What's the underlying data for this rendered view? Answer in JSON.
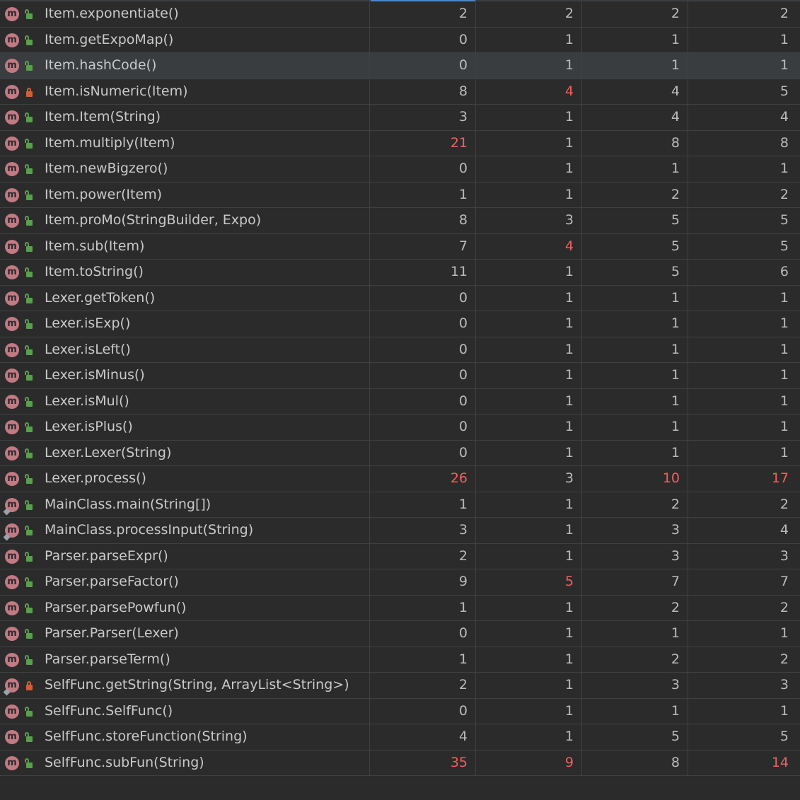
{
  "colors": {
    "background": "#2b2b2b",
    "text": "#bbbbbb",
    "warning_value": "#f16060",
    "method_icon": "#c27a84",
    "public_lock": "#5a9e4e",
    "private_lock": "#d05f36"
  },
  "rows": [
    {
      "method": "Item.exponentiate()",
      "values": [
        "2",
        "2",
        "2",
        "2"
      ],
      "red": [
        false,
        false,
        false,
        false
      ],
      "access": "public",
      "static": false,
      "selected": false
    },
    {
      "method": "Item.getExpoMap()",
      "values": [
        "0",
        "1",
        "1",
        "1"
      ],
      "red": [
        false,
        false,
        false,
        false
      ],
      "access": "public",
      "static": false,
      "selected": false
    },
    {
      "method": "Item.hashCode()",
      "values": [
        "0",
        "1",
        "1",
        "1"
      ],
      "red": [
        false,
        false,
        false,
        false
      ],
      "access": "public",
      "static": false,
      "selected": true
    },
    {
      "method": "Item.isNumeric(Item)",
      "values": [
        "8",
        "4",
        "4",
        "5"
      ],
      "red": [
        false,
        true,
        false,
        false
      ],
      "access": "private",
      "static": false,
      "selected": false
    },
    {
      "method": "Item.Item(String)",
      "values": [
        "3",
        "1",
        "4",
        "4"
      ],
      "red": [
        false,
        false,
        false,
        false
      ],
      "access": "public",
      "static": false,
      "selected": false
    },
    {
      "method": "Item.multiply(Item)",
      "values": [
        "21",
        "1",
        "8",
        "8"
      ],
      "red": [
        true,
        false,
        false,
        false
      ],
      "access": "public",
      "static": false,
      "selected": false
    },
    {
      "method": "Item.newBigzero()",
      "values": [
        "0",
        "1",
        "1",
        "1"
      ],
      "red": [
        false,
        false,
        false,
        false
      ],
      "access": "public",
      "static": false,
      "selected": false
    },
    {
      "method": "Item.power(Item)",
      "values": [
        "1",
        "1",
        "2",
        "2"
      ],
      "red": [
        false,
        false,
        false,
        false
      ],
      "access": "public",
      "static": false,
      "selected": false
    },
    {
      "method": "Item.proMo(StringBuilder, Expo)",
      "values": [
        "8",
        "3",
        "5",
        "5"
      ],
      "red": [
        false,
        false,
        false,
        false
      ],
      "access": "public",
      "static": false,
      "selected": false
    },
    {
      "method": "Item.sub(Item)",
      "values": [
        "7",
        "4",
        "5",
        "5"
      ],
      "red": [
        false,
        true,
        false,
        false
      ],
      "access": "public",
      "static": false,
      "selected": false
    },
    {
      "method": "Item.toString()",
      "values": [
        "11",
        "1",
        "5",
        "6"
      ],
      "red": [
        false,
        false,
        false,
        false
      ],
      "access": "public",
      "static": false,
      "selected": false
    },
    {
      "method": "Lexer.getToken()",
      "values": [
        "0",
        "1",
        "1",
        "1"
      ],
      "red": [
        false,
        false,
        false,
        false
      ],
      "access": "public",
      "static": false,
      "selected": false
    },
    {
      "method": "Lexer.isExp()",
      "values": [
        "0",
        "1",
        "1",
        "1"
      ],
      "red": [
        false,
        false,
        false,
        false
      ],
      "access": "public",
      "static": false,
      "selected": false
    },
    {
      "method": "Lexer.isLeft()",
      "values": [
        "0",
        "1",
        "1",
        "1"
      ],
      "red": [
        false,
        false,
        false,
        false
      ],
      "access": "public",
      "static": false,
      "selected": false
    },
    {
      "method": "Lexer.isMinus()",
      "values": [
        "0",
        "1",
        "1",
        "1"
      ],
      "red": [
        false,
        false,
        false,
        false
      ],
      "access": "public",
      "static": false,
      "selected": false
    },
    {
      "method": "Lexer.isMul()",
      "values": [
        "0",
        "1",
        "1",
        "1"
      ],
      "red": [
        false,
        false,
        false,
        false
      ],
      "access": "public",
      "static": false,
      "selected": false
    },
    {
      "method": "Lexer.isPlus()",
      "values": [
        "0",
        "1",
        "1",
        "1"
      ],
      "red": [
        false,
        false,
        false,
        false
      ],
      "access": "public",
      "static": false,
      "selected": false
    },
    {
      "method": "Lexer.Lexer(String)",
      "values": [
        "0",
        "1",
        "1",
        "1"
      ],
      "red": [
        false,
        false,
        false,
        false
      ],
      "access": "public",
      "static": false,
      "selected": false
    },
    {
      "method": "Lexer.process()",
      "values": [
        "26",
        "3",
        "10",
        "17"
      ],
      "red": [
        true,
        false,
        true,
        true
      ],
      "access": "public",
      "static": false,
      "selected": false
    },
    {
      "method": "MainClass.main(String[])",
      "values": [
        "1",
        "1",
        "2",
        "2"
      ],
      "red": [
        false,
        false,
        false,
        false
      ],
      "access": "public",
      "static": true,
      "selected": false
    },
    {
      "method": "MainClass.processInput(String)",
      "values": [
        "3",
        "1",
        "3",
        "4"
      ],
      "red": [
        false,
        false,
        false,
        false
      ],
      "access": "public",
      "static": true,
      "selected": false
    },
    {
      "method": "Parser.parseExpr()",
      "values": [
        "2",
        "1",
        "3",
        "3"
      ],
      "red": [
        false,
        false,
        false,
        false
      ],
      "access": "public",
      "static": false,
      "selected": false
    },
    {
      "method": "Parser.parseFactor()",
      "values": [
        "9",
        "5",
        "7",
        "7"
      ],
      "red": [
        false,
        true,
        false,
        false
      ],
      "access": "public",
      "static": false,
      "selected": false
    },
    {
      "method": "Parser.parsePowfun()",
      "values": [
        "1",
        "1",
        "2",
        "2"
      ],
      "red": [
        false,
        false,
        false,
        false
      ],
      "access": "public",
      "static": false,
      "selected": false
    },
    {
      "method": "Parser.Parser(Lexer)",
      "values": [
        "0",
        "1",
        "1",
        "1"
      ],
      "red": [
        false,
        false,
        false,
        false
      ],
      "access": "public",
      "static": false,
      "selected": false
    },
    {
      "method": "Parser.parseTerm()",
      "values": [
        "1",
        "1",
        "2",
        "2"
      ],
      "red": [
        false,
        false,
        false,
        false
      ],
      "access": "public",
      "static": false,
      "selected": false
    },
    {
      "method": "SelfFunc.getString(String, ArrayList<String>)",
      "values": [
        "2",
        "1",
        "3",
        "3"
      ],
      "red": [
        false,
        false,
        false,
        false
      ],
      "access": "private",
      "static": true,
      "selected": false
    },
    {
      "method": "SelfFunc.SelfFunc()",
      "values": [
        "0",
        "1",
        "1",
        "1"
      ],
      "red": [
        false,
        false,
        false,
        false
      ],
      "access": "public",
      "static": false,
      "selected": false
    },
    {
      "method": "SelfFunc.storeFunction(String)",
      "values": [
        "4",
        "1",
        "5",
        "5"
      ],
      "red": [
        false,
        false,
        false,
        false
      ],
      "access": "public",
      "static": false,
      "selected": false
    },
    {
      "method": "SelfFunc.subFun(String)",
      "values": [
        "35",
        "9",
        "8",
        "14"
      ],
      "red": [
        true,
        true,
        false,
        true
      ],
      "access": "public",
      "static": false,
      "selected": false
    }
  ],
  "icons": {
    "method": "method-icon",
    "method_letter": "m",
    "public": "unlocked-icon",
    "private": "locked-icon",
    "static": "static-marker-icon"
  }
}
